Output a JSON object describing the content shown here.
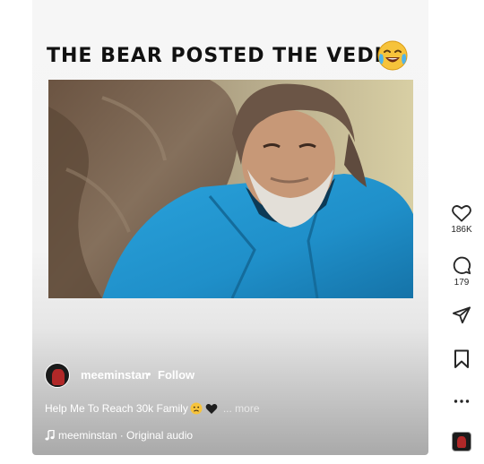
{
  "post": {
    "overlay_title": "THE BEAR POSTED THE VEDIO",
    "overlay_emoji": "laughing-crying-emoji"
  },
  "author": {
    "username": "meeminstan",
    "separator": "•",
    "follow_label": "Follow"
  },
  "caption": {
    "text": "Help Me To Reach 30k Family",
    "emojis": [
      "sad-face-emoji",
      "black-heart-emoji"
    ],
    "more_label": "... more"
  },
  "audio": {
    "label": "meeminstan · Original audio",
    "icon": "music-note-icon"
  },
  "actions": {
    "like_count": "186K",
    "comment_count": "179",
    "icons": [
      "heart-icon",
      "comment-icon",
      "share-icon",
      "bookmark-icon",
      "more-icon"
    ]
  },
  "colors": {
    "overlay_text": "#111111",
    "shirt_blue": "#1f8fc9",
    "icon_stroke": "#262626"
  }
}
